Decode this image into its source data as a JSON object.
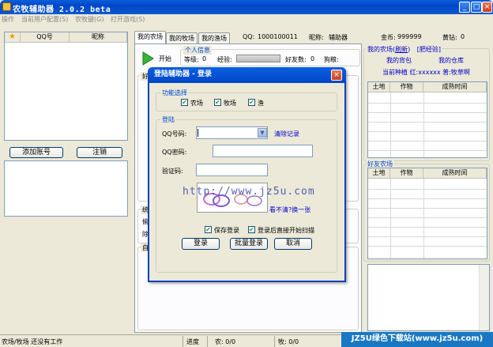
{
  "window": {
    "title": "农牧辅助器 2.0.2 beta"
  },
  "menu": [
    "操作",
    "当前用户配置(S)",
    "农牧键(G)",
    "打开游戏(S)"
  ],
  "accounts_table": {
    "headers": [
      "QQ号",
      "昵称"
    ]
  },
  "left_buttons": {
    "add": "添加账号",
    "remove": "注销"
  },
  "tabs": [
    "我的农场",
    "我的牧场",
    "我的渔场"
  ],
  "user": {
    "qq_label": "QQ:",
    "qq": "1000100011",
    "nick_label": "昵称:",
    "nick": "辅助器",
    "coins_label": "金币:",
    "coins": "999999",
    "gold_label": "黄钻:",
    "gold": "0"
  },
  "start_label": "开始",
  "personal": {
    "title": "个人信息",
    "level_label": "等级:",
    "level": "0",
    "exp_label": "经验:",
    "friends_label": "好友数:",
    "friends": "0",
    "dog_label": "狗粮:"
  },
  "friends_short": "好",
  "middle_labels": {
    "a": "统",
    "b": "自",
    "fruit": "偷",
    "remove": "除"
  },
  "right": {
    "my_farm_title": "我的农场(",
    "refresh": "刷新",
    "sep": ")",
    "fertilize": "[肥经验]",
    "my_bag": "我的背包",
    "my_warehouse": "我的仓库",
    "crop_info": "当前种植 红:xxxxxx 普:牧草啊",
    "table_headers": [
      "土地",
      "作物",
      "成熟时间"
    ],
    "friend_farm_title": "好友农场",
    "friend_headers": [
      "土地",
      "作物",
      "成熟时间"
    ]
  },
  "dialog": {
    "title": "登陆辅助器 - 登录",
    "func_group": "功能选择",
    "options": [
      "农场",
      "牧场",
      "渔"
    ],
    "login_group": "登陆",
    "qq_label": "QQ号码:",
    "clear_link": "清除记录",
    "pwd_label": "QQ密码:",
    "captcha_label": "验证码:",
    "captcha_text": "http://www.jz5u.com",
    "refresh_captcha": "看不清?换一张",
    "save_login": "保存登录",
    "auto_scan": "登录后直接开始扫描",
    "btn_login": "登录",
    "btn_batch": "批量登录",
    "btn_cancel": "取消"
  },
  "status": {
    "left": "农场/牧场  还没有工作",
    "progress_label": "进度",
    "farm": "农: 0/0",
    "ranch": "牧: 0/0"
  },
  "watermark": "JZ5U绿色下载站(www.jz5u.com)",
  "colors": {
    "titlebar": "#0046c8",
    "link": "#0000c8",
    "group_title": "#0046d5",
    "watermark": "#1a78c2"
  }
}
